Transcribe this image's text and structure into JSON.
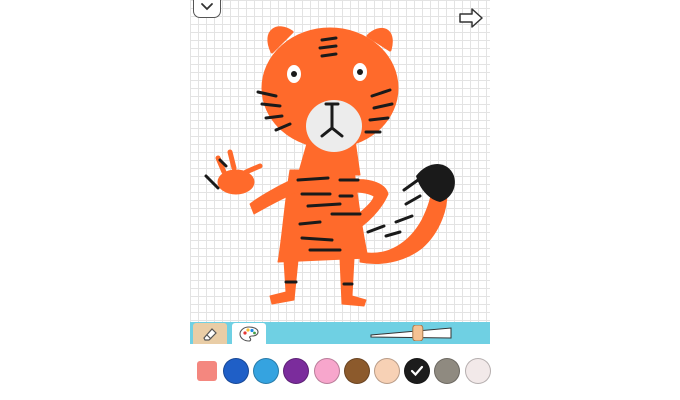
{
  "app": {
    "screen": "tiger-drawing-editor"
  },
  "icons": {
    "collapse": "chevron-down-icon",
    "share": "share-arrow-icon",
    "eraser": "eraser-icon",
    "palette": "palette-icon",
    "selected": "check-icon"
  },
  "colors": {
    "toolbar": "#6fd0e3",
    "grid": "#e3e3e3",
    "tiger_orange": "#ff6a2b",
    "stripe_black": "#1a1a1a",
    "muzzle_white": "#ececec"
  },
  "brush": {
    "size_level": 0.6
  },
  "swatches": {
    "custom_color": "#f4877f",
    "items": [
      {
        "color": "#1f5fc7",
        "selected": false
      },
      {
        "color": "#35a3e0",
        "selected": false
      },
      {
        "color": "#7b2c9c",
        "selected": false
      },
      {
        "color": "#f7a6cc",
        "selected": false
      },
      {
        "color": "#8c5a2c",
        "selected": false
      },
      {
        "color": "#f7d1b5",
        "selected": false
      },
      {
        "color": "#1c1c1c",
        "selected": true
      },
      {
        "color": "#8f8a80",
        "selected": false
      },
      {
        "color": "#f2e9e9",
        "selected": false
      }
    ]
  }
}
